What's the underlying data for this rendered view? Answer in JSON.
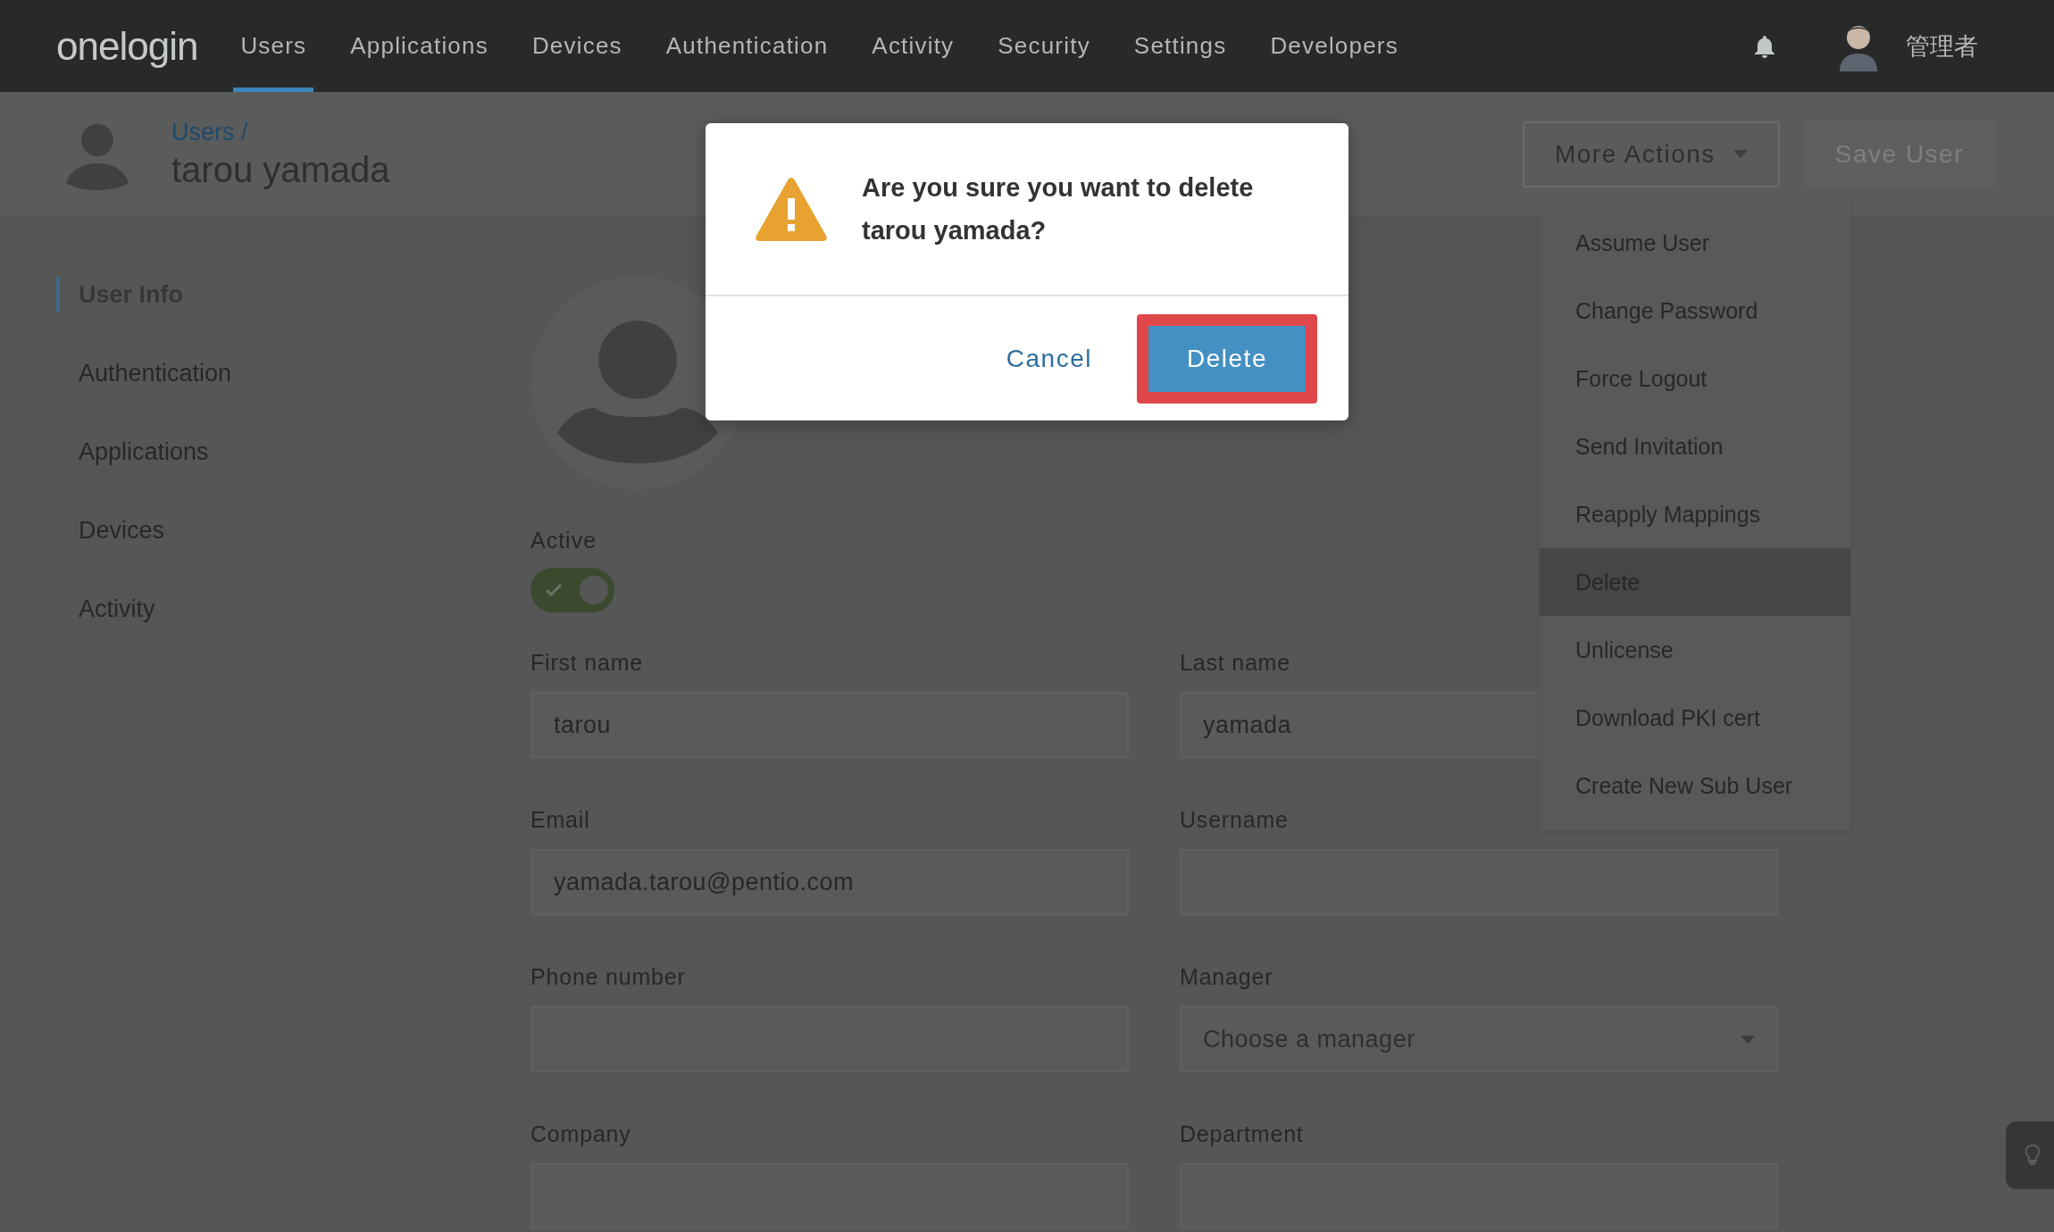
{
  "nav": {
    "logo": "onelogin",
    "items": [
      {
        "label": "Users",
        "selected": true
      },
      {
        "label": "Applications",
        "selected": false
      },
      {
        "label": "Devices",
        "selected": false
      },
      {
        "label": "Authentication",
        "selected": false
      },
      {
        "label": "Activity",
        "selected": false
      },
      {
        "label": "Security",
        "selected": false
      },
      {
        "label": "Settings",
        "selected": false
      },
      {
        "label": "Developers",
        "selected": false
      }
    ],
    "user": {
      "name": "管理者"
    }
  },
  "page_header": {
    "breadcrumb": "Users /",
    "title": "tarou yamada",
    "buttons": [
      {
        "label": "More Actions",
        "kind": "dropdown",
        "disabled": false
      },
      {
        "label": "Save User",
        "kind": "primary",
        "disabled": true
      }
    ]
  },
  "actions_menu": {
    "items": [
      {
        "label": "Assume User",
        "highlighted": false
      },
      {
        "label": "Change Password",
        "highlighted": false
      },
      {
        "label": "Force Logout",
        "highlighted": false
      },
      {
        "label": "Send Invitation",
        "highlighted": false
      },
      {
        "label": "Reapply Mappings",
        "highlighted": false
      },
      {
        "label": "Delete",
        "highlighted": true
      },
      {
        "label": "Unlicense",
        "highlighted": false
      },
      {
        "label": "Download PKI cert",
        "highlighted": false
      },
      {
        "label": "Create New Sub User",
        "highlighted": false
      }
    ]
  },
  "sidebar": {
    "items": [
      {
        "label": "User Info",
        "selected": true
      },
      {
        "label": "Authentication",
        "selected": false
      },
      {
        "label": "Applications",
        "selected": false
      },
      {
        "label": "Devices",
        "selected": false
      },
      {
        "label": "Activity",
        "selected": false
      }
    ]
  },
  "profile": {
    "active_label": "Active",
    "active": true
  },
  "form": {
    "fields": [
      {
        "label": "First name",
        "kind": "text",
        "value": "tarou"
      },
      {
        "label": "Last name",
        "kind": "text",
        "value": "yamada"
      },
      {
        "label": "Email",
        "kind": "text",
        "value": "yamada.tarou@pentio.com"
      },
      {
        "label": "Username",
        "kind": "text"
      },
      {
        "label": "Phone number",
        "kind": "text"
      },
      {
        "label": "Manager",
        "kind": "select",
        "placeholder": "Choose a manager"
      },
      {
        "label": "Company",
        "kind": "text"
      },
      {
        "label": "Department",
        "kind": "text"
      }
    ]
  },
  "dialog": {
    "message": "Are you sure you want to delete tarou yamada?",
    "buttons": [
      {
        "label": "Cancel",
        "kind": "link",
        "annotated": false
      },
      {
        "label": "Delete",
        "kind": "primary",
        "annotated": true
      }
    ]
  }
}
